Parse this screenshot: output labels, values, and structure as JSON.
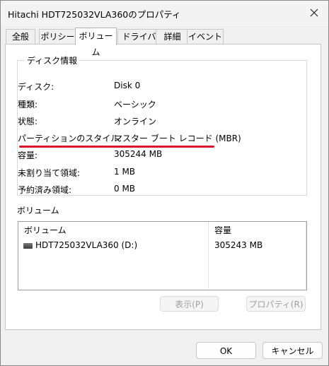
{
  "window": {
    "title": "Hitachi HDT725032VLA360のプロパティ",
    "close_icon": "close-icon"
  },
  "tabs": [
    {
      "label": "全般"
    },
    {
      "label": "ポリシー"
    },
    {
      "label": "ボリューム",
      "active": true
    },
    {
      "label": "ドライバー"
    },
    {
      "label": "詳細"
    },
    {
      "label": "イベント"
    }
  ],
  "disk_info": {
    "group_label": "ディスク情報",
    "rows": [
      {
        "label": "ディスク:",
        "value": "Disk 0"
      },
      {
        "label": "種類:",
        "value": "ベーシック"
      },
      {
        "label": "状態:",
        "value": "オンライン"
      },
      {
        "label": "パーティションのスタイル:",
        "value": "マスター ブート レコード (MBR)"
      },
      {
        "label": "容量:",
        "value": "305244 MB"
      },
      {
        "label": "未割り当て領域:",
        "value": "1 MB"
      },
      {
        "label": "予約済み領域:",
        "value": "0 MB"
      }
    ]
  },
  "volumes": {
    "section_label": "ボリューム",
    "columns": [
      "ボリューム",
      "容量"
    ],
    "rows": [
      {
        "icon": "drive-icon",
        "name": "HDT725032VLA360 (D:)",
        "capacity": "305243 MB"
      }
    ],
    "buttons": {
      "show": "表示(P)",
      "properties": "プロパティ(R)"
    }
  },
  "footer": {
    "ok": "OK",
    "cancel": "キャンセル"
  },
  "colors": {
    "highlight_line": "#d8152a"
  }
}
